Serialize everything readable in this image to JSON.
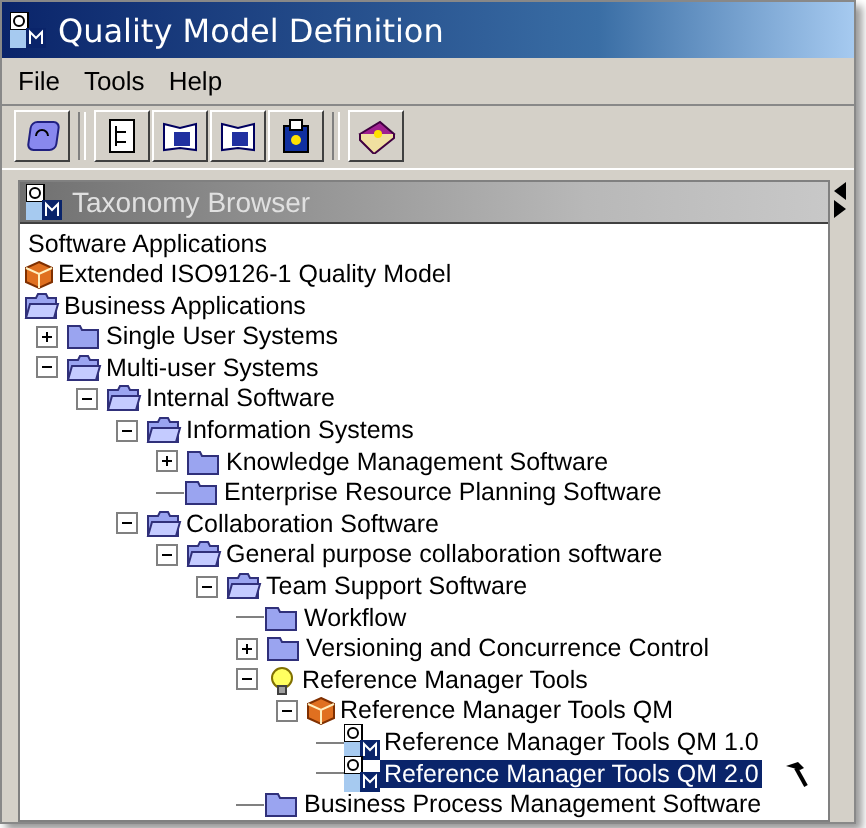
{
  "window": {
    "title": "Quality Model Definition"
  },
  "menu": [
    "File",
    "Tools",
    "Help"
  ],
  "toolbar": [
    {
      "kind": "refresh"
    },
    {
      "kind": "separator"
    },
    {
      "kind": "tree"
    },
    {
      "kind": "book-m"
    },
    {
      "kind": "book-g"
    },
    {
      "kind": "clip-g"
    },
    {
      "kind": "separator"
    },
    {
      "kind": "help-book"
    }
  ],
  "panel": {
    "title": "Taxonomy Browser"
  },
  "tree": [
    {
      "label": "Software Applications",
      "kind": "text"
    },
    {
      "label": "Extended ISO9126-1 Quality Model",
      "kind": "cube"
    },
    {
      "label": "Business Applications",
      "kind": "folder",
      "expanded": true,
      "children": [
        {
          "label": "Single User Systems",
          "kind": "folder",
          "expanded": false
        },
        {
          "label": "Multi-user Systems",
          "kind": "folder",
          "expanded": true,
          "children": [
            {
              "label": "Internal Software",
              "kind": "folder",
              "expanded": true,
              "children": [
                {
                  "label": "Information Systems",
                  "kind": "folder",
                  "expanded": true,
                  "children": [
                    {
                      "label": "Knowledge Management Software",
                      "kind": "folder",
                      "expanded": false
                    },
                    {
                      "label": "Enterprise Resource Planning Software",
                      "kind": "folder"
                    }
                  ]
                },
                {
                  "label": "Collaboration Software",
                  "kind": "folder",
                  "expanded": true,
                  "children": [
                    {
                      "label": "General purpose collaboration software",
                      "kind": "folder",
                      "expanded": true,
                      "children": [
                        {
                          "label": "Team Support Software",
                          "kind": "folder",
                          "expanded": true,
                          "children": [
                            {
                              "label": "Workflow",
                              "kind": "folder"
                            },
                            {
                              "label": "Versioning and Concurrence Control",
                              "kind": "folder",
                              "expanded": false
                            },
                            {
                              "label": "Reference Manager Tools",
                              "kind": "bulb",
                              "expanded": true,
                              "children": [
                                {
                                  "label": "Reference Manager Tools QM",
                                  "kind": "cube",
                                  "expanded": true,
                                  "children": [
                                    {
                                      "label": "Reference Manager Tools QM 1.0",
                                      "kind": "qm",
                                      "selected": false
                                    },
                                    {
                                      "label": "Reference Manager Tools QM 2.0",
                                      "kind": "qm",
                                      "selected": true
                                    }
                                  ]
                                }
                              ]
                            },
                            {
                              "label": "Business Process Management Software",
                              "kind": "folder"
                            }
                          ]
                        }
                      ]
                    }
                  ]
                }
              ]
            }
          ]
        }
      ]
    }
  ]
}
